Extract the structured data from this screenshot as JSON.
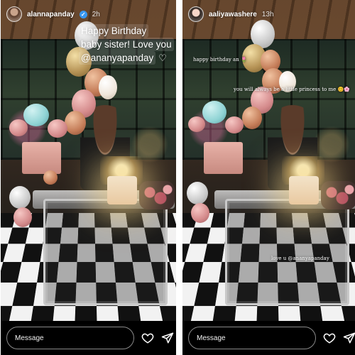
{
  "stories": [
    {
      "username": "alannapanday",
      "verified": true,
      "time": "2h",
      "caption_lines": [
        "Happy Birthday",
        "baby sister! Love you",
        "@ananyapanday"
      ],
      "message_placeholder": "Message"
    },
    {
      "username": "aaliyawashere",
      "verified": false,
      "time": "13h",
      "captions": [
        "happy birthday an 🌷",
        "you will always be a little princess to me 😊🌸",
        "love u @ananyapanday"
      ],
      "message_placeholder": "Message"
    }
  ],
  "icons": [
    "verified-badge-icon",
    "heart-icon",
    "send-icon"
  ],
  "colors": {
    "verified": "#3897f0",
    "background": "#000000",
    "text": "#ffffff"
  }
}
